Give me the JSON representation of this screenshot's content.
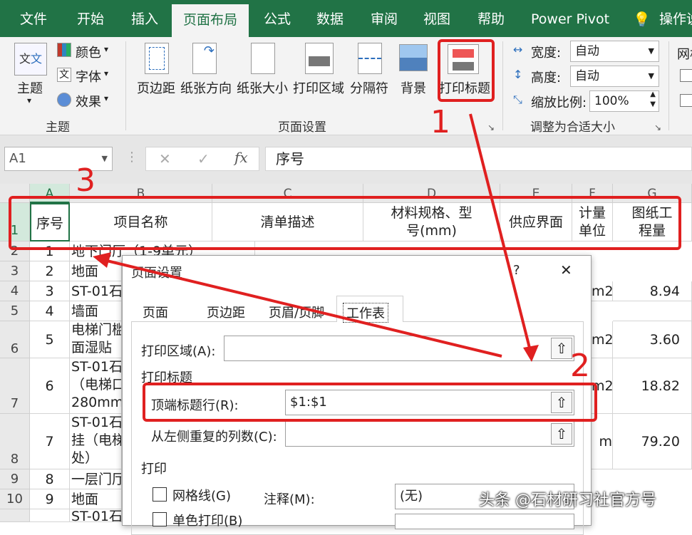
{
  "ribbon_tabs": [
    "文件",
    "开始",
    "插入",
    "页面布局",
    "公式",
    "数据",
    "审阅",
    "视图",
    "帮助",
    "Power Pivot",
    "操作说"
  ],
  "theme_group": {
    "themes_label": "主题",
    "colors_label": "颜色",
    "fonts_label": "字体",
    "effects_label": "效果",
    "group_label": "主题"
  },
  "page_setup_group": {
    "margins": "页边距",
    "orientation": "纸张方向",
    "size": "纸张大小",
    "print_area": "打印区域",
    "breaks": "分隔符",
    "background": "背景",
    "print_titles": "打印标题",
    "group_label": "页面设置"
  },
  "scale_group": {
    "width_label": "宽度:",
    "width_value": "自动",
    "height_label": "高度:",
    "height_value": "自动",
    "scale_label": "缩放比例:",
    "scale_value": "100%",
    "group_label": "调整为合适大小"
  },
  "sheet_options": {
    "label": "网格"
  },
  "formula_bar": {
    "name_box": "A1",
    "fx": "fx",
    "content": "序号"
  },
  "columns": [
    "A",
    "B",
    "C",
    "D",
    "E",
    "F",
    "G"
  ],
  "header_row": [
    "序号",
    "项目名称",
    "清单描述",
    "材料规格、型号(mm)",
    "供应界面",
    "计量单位",
    "图纸工程量"
  ],
  "rows": [
    {
      "num": "2",
      "a": "1",
      "b": "地下门厅（1-9单元）",
      "g": ""
    },
    {
      "num": "3",
      "a": "2",
      "b": "地面",
      "g": ""
    },
    {
      "num": "4",
      "a": "3",
      "b": "ST-01石",
      "f": "m2",
      "g": "8.94"
    },
    {
      "num": "5",
      "a": "4",
      "b": "墙面",
      "g": ""
    },
    {
      "num": "6",
      "a": "5",
      "b": "电梯门槛\n面湿贴",
      "f": "m2",
      "g": "3.60"
    },
    {
      "num": "7",
      "a": "6",
      "b": "ST-01石\n（电梯口\n280mm宽",
      "f": "m2",
      "g": "18.82"
    },
    {
      "num": "8",
      "a": "7",
      "b": "ST-01石\n挂（电梯\n处）",
      "f": "m",
      "g": "79.20"
    },
    {
      "num": "9",
      "a": "8",
      "b": "一层门厅",
      "g": ""
    },
    {
      "num": "10",
      "a": "9",
      "b": "地面",
      "g": ""
    },
    {
      "num": "",
      "a": "",
      "b": "ST-01石",
      "g": ""
    }
  ],
  "dialog": {
    "title": "页面设置",
    "help": "?",
    "close": "✕",
    "tabs": [
      "页面",
      "页边距",
      "页眉/页脚",
      "工作表"
    ],
    "print_area_label": "打印区域(A):",
    "print_titles_section": "打印标题",
    "top_rows_label": "顶端标题行(R):",
    "top_rows_value": "$1:$1",
    "left_cols_label": "从左侧重复的列数(C):",
    "print_section": "打印",
    "gridlines_label": "网格线(G)",
    "mono_label": "单色打印(B)",
    "comments_label": "注释(M):",
    "comments_value": "(无)"
  },
  "annotations": [
    "1",
    "2",
    "3"
  ],
  "watermark": "头条 @石材研习社官方号",
  "colors": {
    "excel_green": "#217346",
    "annotation_red": "#e02020"
  }
}
